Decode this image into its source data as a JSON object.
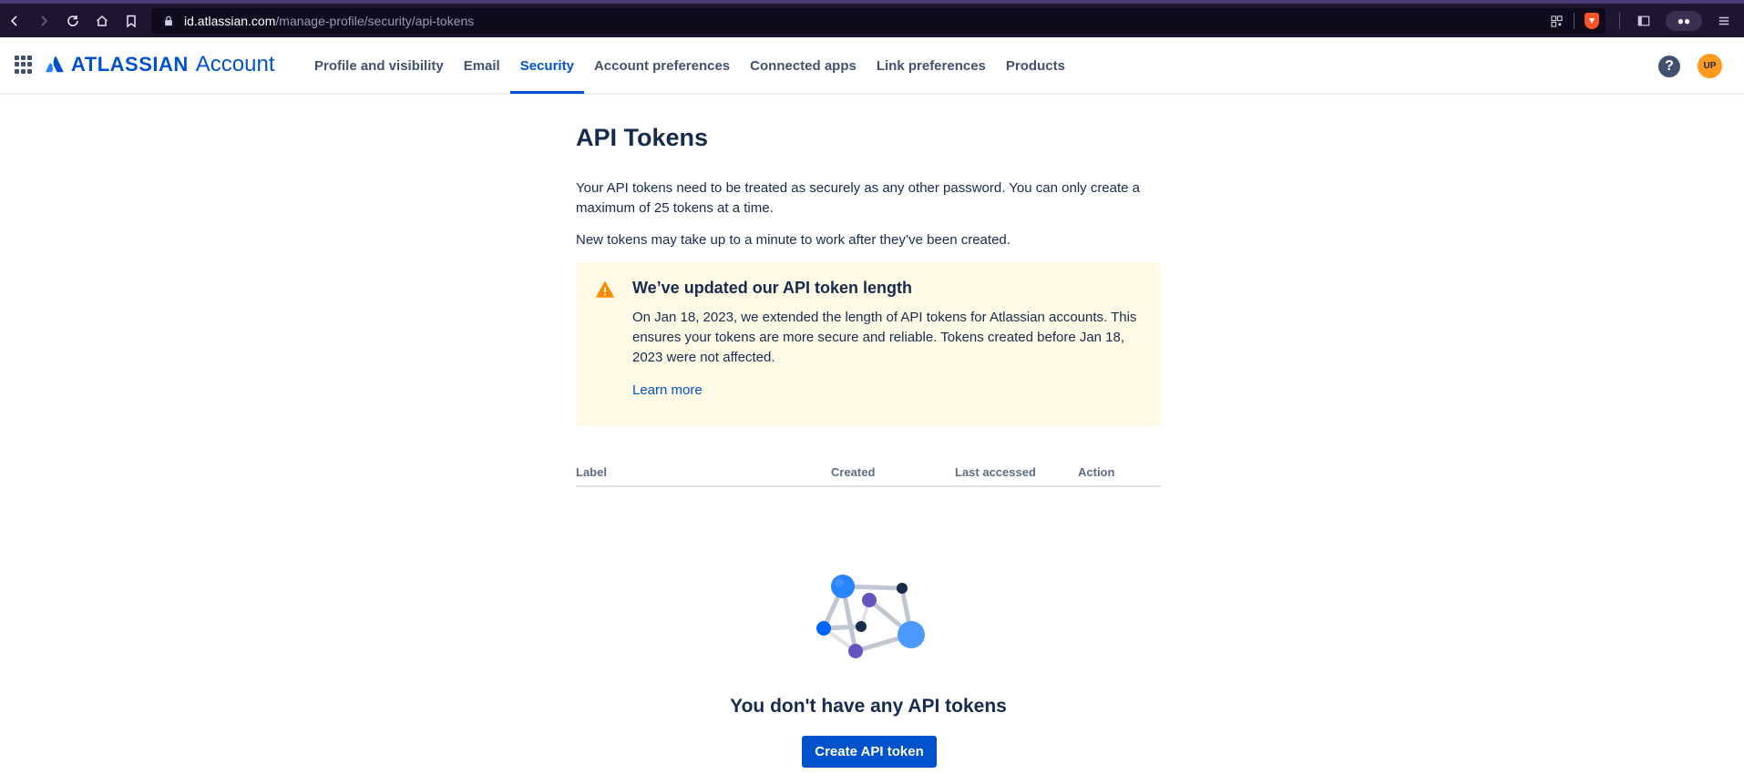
{
  "browser": {
    "url_host": "id.atlassian.com",
    "url_path": "/manage-profile/security/api-tokens"
  },
  "header": {
    "logo_word": "ATLASSIAN",
    "logo_product": "Account",
    "tabs": [
      {
        "label": "Profile and visibility",
        "active": false
      },
      {
        "label": "Email",
        "active": false
      },
      {
        "label": "Security",
        "active": true
      },
      {
        "label": "Account preferences",
        "active": false
      },
      {
        "label": "Connected apps",
        "active": false
      },
      {
        "label": "Link preferences",
        "active": false
      },
      {
        "label": "Products",
        "active": false
      }
    ],
    "help_glyph": "?",
    "avatar_initials": "UP"
  },
  "page": {
    "title": "API Tokens",
    "intro": "Your API tokens need to be treated as securely as any other password. You can only create a maximum of 25 tokens at a time.",
    "note": "New tokens may take up to a minute to work after they’ve been created."
  },
  "banner": {
    "title": "We’ve updated our API token length",
    "body": "On Jan 18, 2023, we extended the length of API tokens for Atlassian accounts. This ensures your tokens are more secure and reliable. Tokens created before Jan 18, 2023 were not affected.",
    "link": "Learn more"
  },
  "table": {
    "columns": [
      "Label",
      "Created",
      "Last accessed",
      "Action"
    ]
  },
  "empty_state": {
    "title": "You don't have any API tokens",
    "button": "Create API token"
  },
  "colors": {
    "brand": "#0052CC",
    "banner_bg": "#FFFAE6",
    "warning": "#FF8B00",
    "avatar": "#FF991F"
  }
}
